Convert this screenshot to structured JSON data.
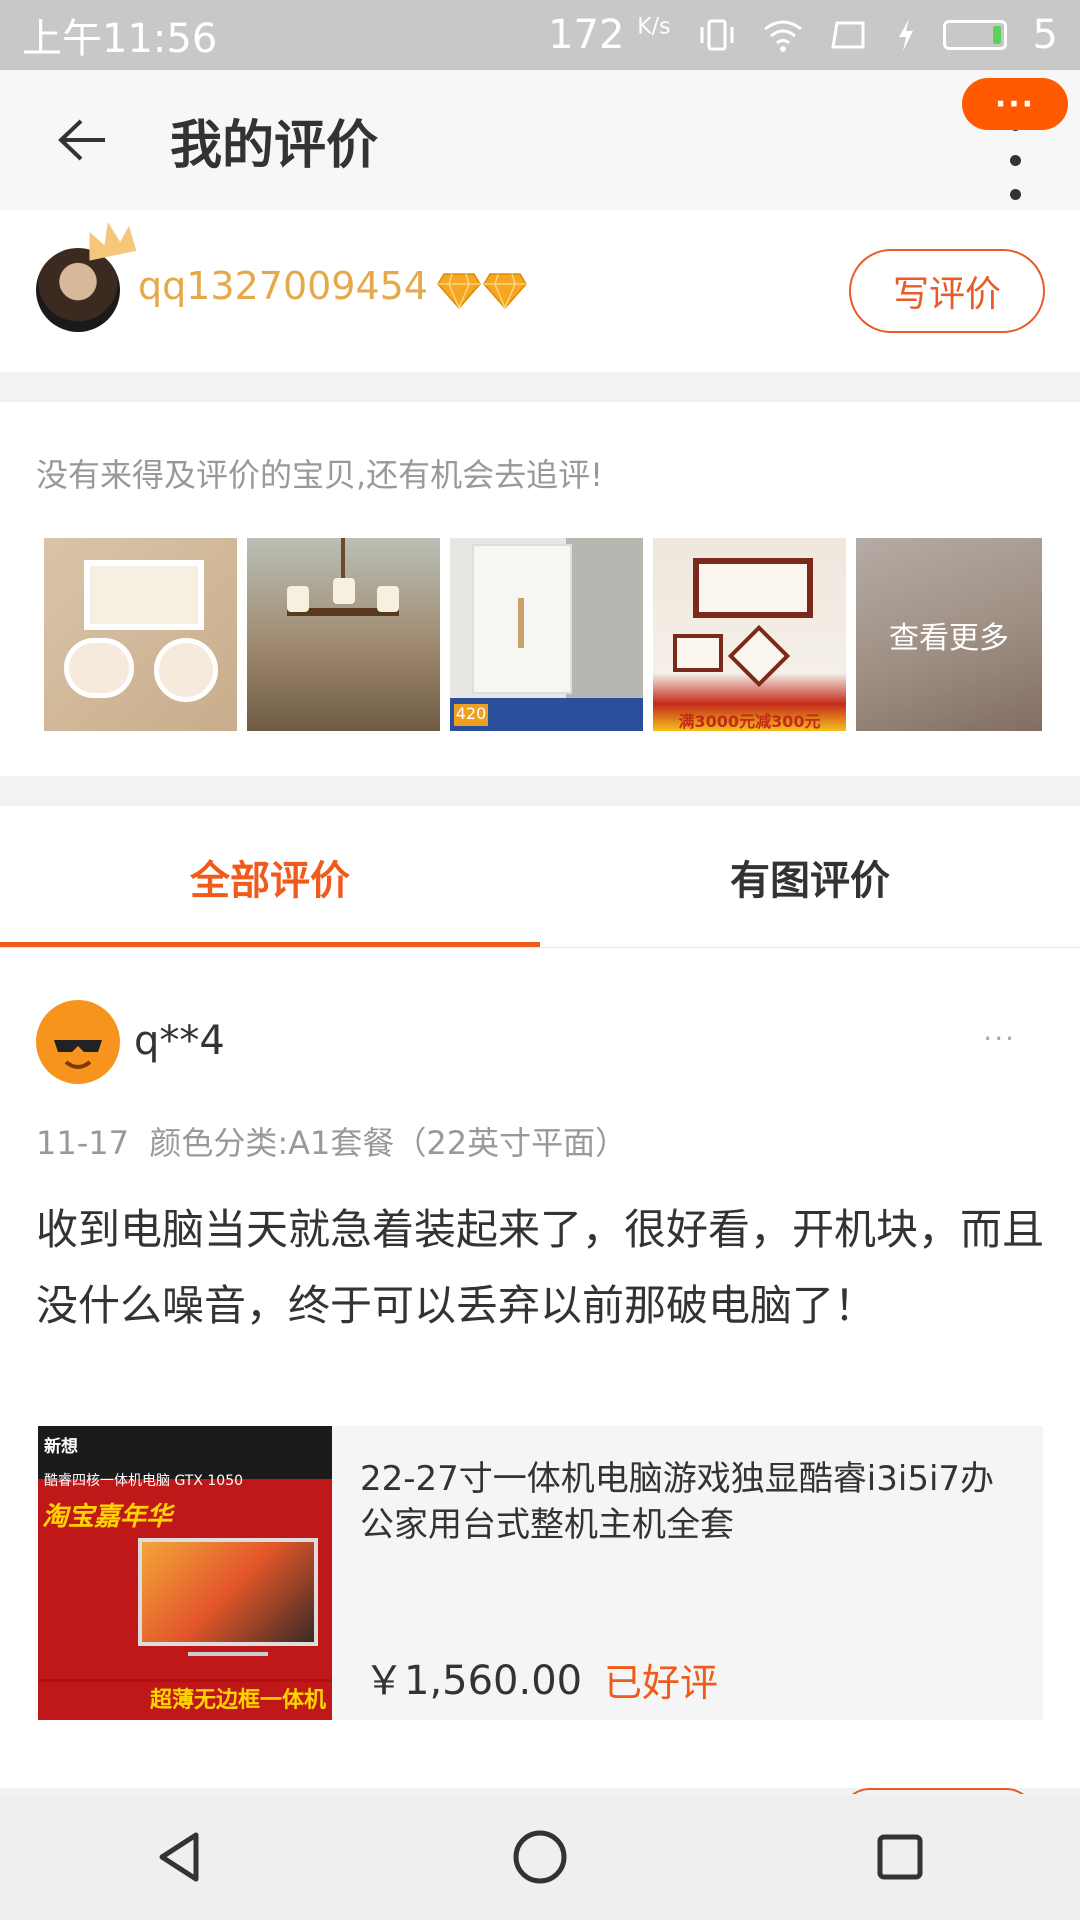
{
  "status_bar": {
    "time": "上午11:56",
    "speed": "172",
    "speed_unit": "K/s",
    "battery_level": "5"
  },
  "app_bar": {
    "title": "我的评价",
    "message_badge": "···"
  },
  "user": {
    "name": "qq1327009454",
    "write_review_label": "写评价"
  },
  "pending": {
    "hint": "没有来得及评价的宝贝,还有机会去追评!",
    "see_more_label": "查看更多",
    "thumb_texts": {
      "t4_price": "满3000元减300元",
      "t3_price": "420"
    }
  },
  "tabs": [
    {
      "label": "全部评价",
      "active": true
    },
    {
      "label": "有图评价",
      "active": false
    }
  ],
  "review": {
    "reviewer": "q**4",
    "more": "···",
    "date": "11-17",
    "sku": "颜色分类:A1套餐（22英寸平面）",
    "text": "收到电脑当天就急着装起来了，很好看，开机块，而且没什么噪音，终于可以丢弃以前那破电脑了！",
    "product": {
      "title": "22-27寸一体机电脑游戏独显酷睿i3i5i7办公家用台式整机主机全套",
      "price": "￥1,560.00",
      "status": "已好评",
      "image_texts": {
        "brand": "新想",
        "subtitle": "酷睿四核一体机电脑 GTX 1050",
        "promo": "淘宝嘉年华",
        "bottom": "超薄无边框一体机"
      }
    }
  },
  "colors": {
    "accent": "#f05a1a",
    "gold": "#e6a94a"
  }
}
